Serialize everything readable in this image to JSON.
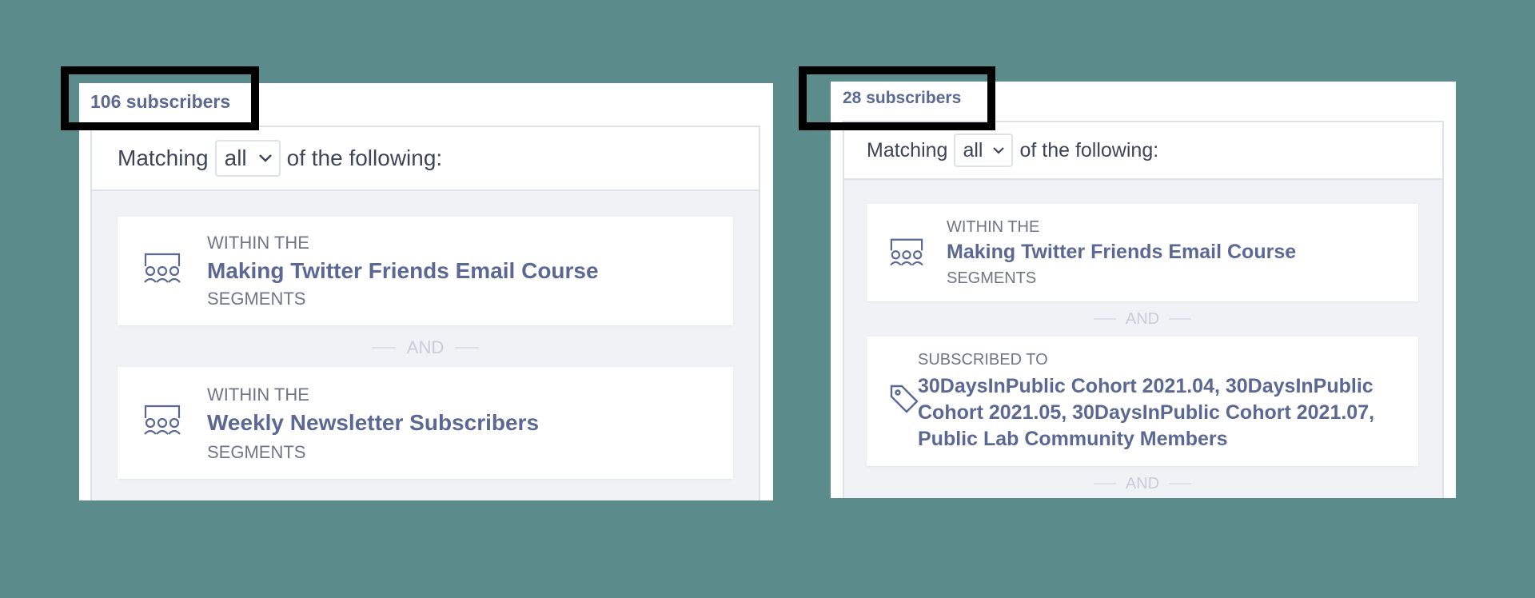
{
  "left_panel": {
    "count": "106 subscribers",
    "matching_prefix": "Matching",
    "matching_select": "all",
    "matching_suffix": "of the following:",
    "conditions": [
      {
        "pre": "WITHIN THE",
        "title": "Making Twitter Friends Email Course",
        "post": "SEGMENTS",
        "icon": "segment-icon"
      },
      {
        "pre": "WITHIN THE",
        "title": "Weekly Newsletter Subscribers",
        "post": "SEGMENTS",
        "icon": "segment-icon"
      }
    ],
    "joiner": "AND"
  },
  "right_panel": {
    "count": "28 subscribers",
    "matching_prefix": "Matching",
    "matching_select": "all",
    "matching_suffix": "of the following:",
    "conditions": [
      {
        "pre": "WITHIN THE",
        "title": "Making Twitter Friends Email Course",
        "post": "SEGMENTS",
        "icon": "segment-icon"
      },
      {
        "pre": "SUBSCRIBED TO",
        "title_lines": [
          "30DaysInPublic Cohort 2021.04, 30DaysInPublic",
          "Cohort 2021.05, 30DaysInPublic Cohort 2021.07,",
          "Public Lab Community Members"
        ],
        "icon": "tag-icon"
      }
    ],
    "joiner": "AND",
    "joiner_bottom": "AND"
  },
  "colors": {
    "background": "#5b8b8a",
    "accent_text": "#5b6894",
    "highlight_box": "#000000"
  }
}
